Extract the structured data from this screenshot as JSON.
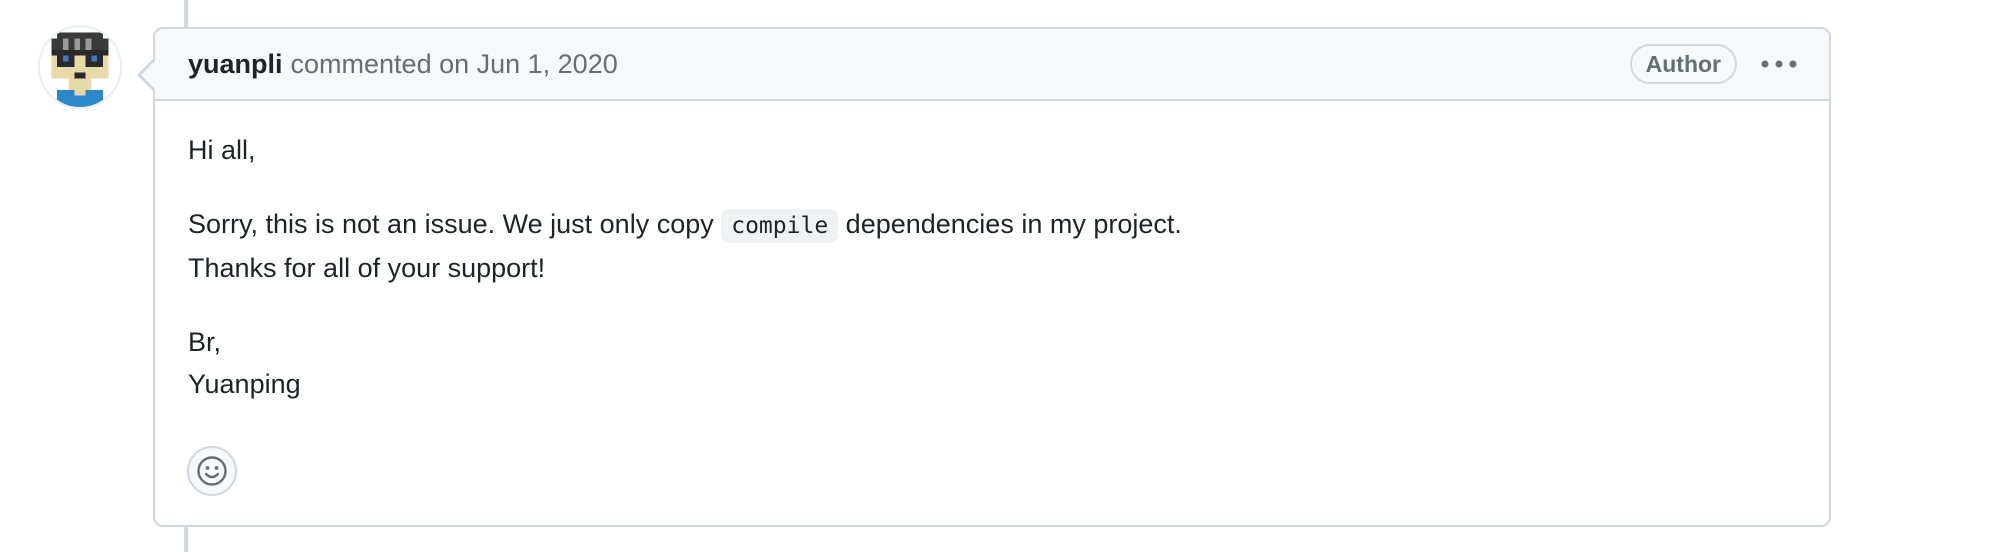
{
  "comment": {
    "author": "yuanpli",
    "action_text": "commented on Jun 1, 2020",
    "badge": "Author",
    "more_icon": "kebab-horizontal-icon",
    "body": {
      "greeting": "Hi all,",
      "line1_before": "Sorry, this is not an issue. We just only copy ",
      "line1_code": "compile",
      "line1_after": " dependencies in my project.",
      "line2": "Thanks for all of your support!",
      "signoff": "Br,",
      "signature": "Yuanping"
    },
    "reaction_icon": "smiley-icon"
  },
  "colors": {
    "border": "#d0d7de",
    "header_bg": "#f6f8fa",
    "muted_text": "#656d76",
    "text": "#1f2328"
  }
}
